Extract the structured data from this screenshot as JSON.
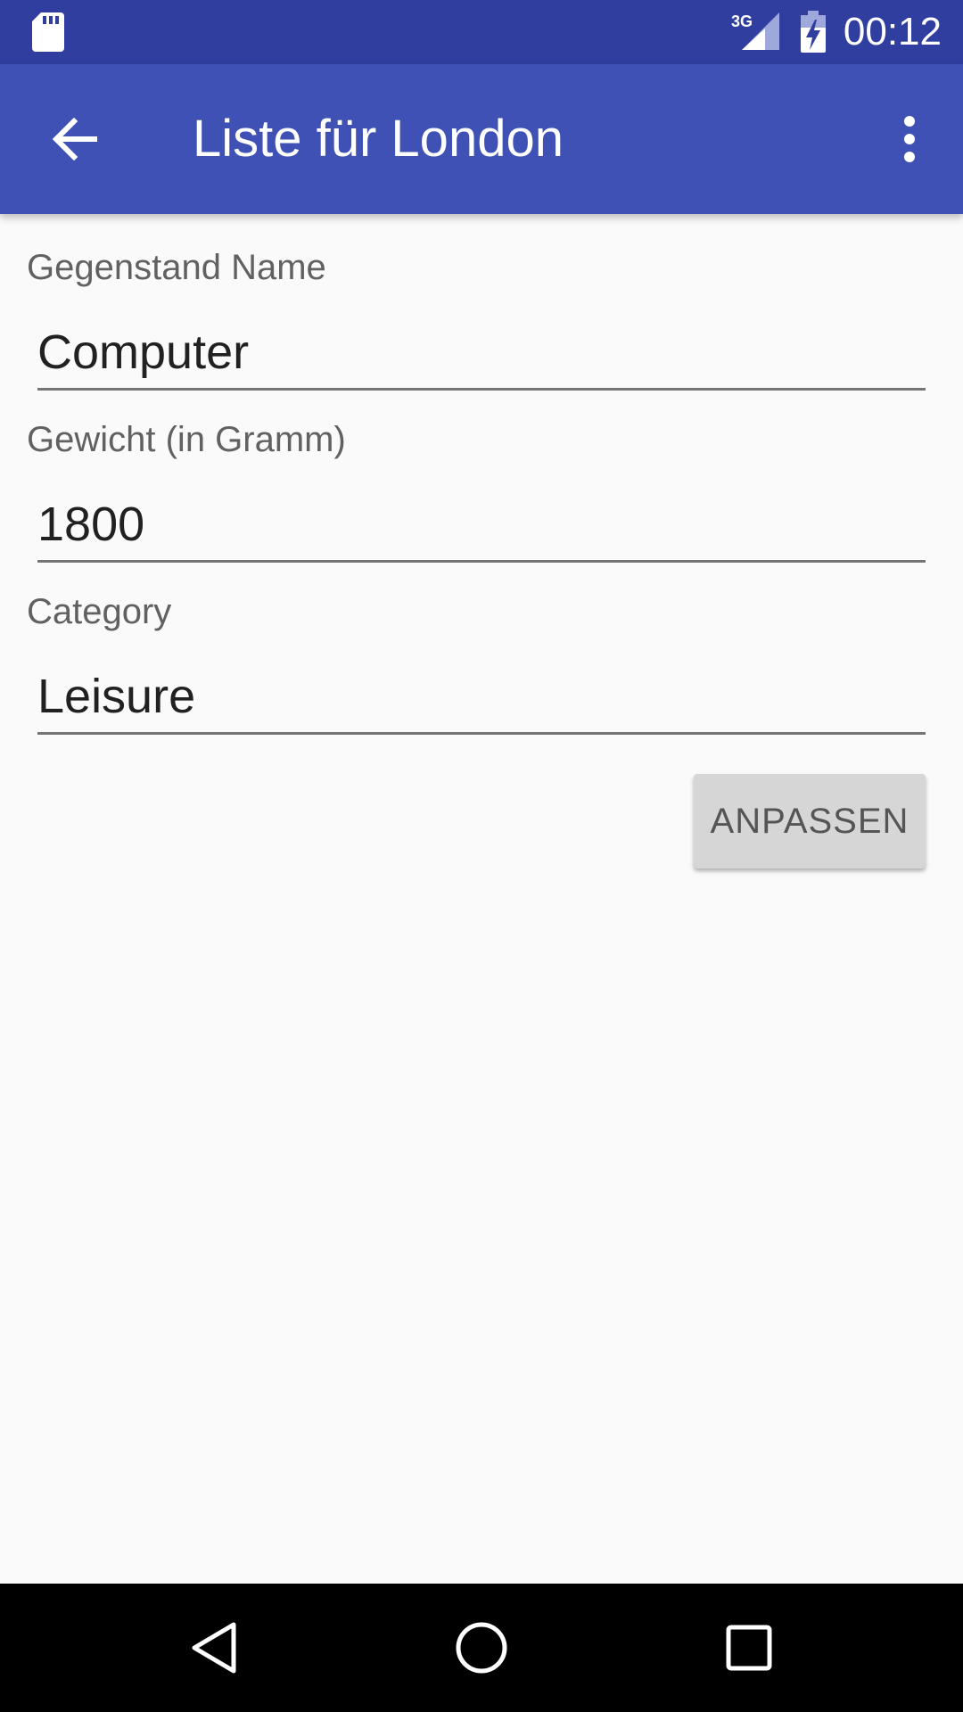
{
  "status_bar": {
    "time": "00:12",
    "network_label": "3G",
    "icons": [
      "sd-card-icon",
      "signal-icon",
      "battery-charging-icon"
    ]
  },
  "app_bar": {
    "title": "Liste für London",
    "back_icon": "arrow-back-icon",
    "menu_icon": "more-vert-icon"
  },
  "form": {
    "name": {
      "label": "Gegenstand Name",
      "value": "Computer"
    },
    "weight": {
      "label": "Gewicht (in Gramm)",
      "value": "1800"
    },
    "category": {
      "label": "Category",
      "value": "Leisure"
    },
    "submit_label": "ANPASSEN"
  },
  "nav_bar": {
    "icons": [
      "back-triangle-icon",
      "home-circle-icon",
      "recents-square-icon"
    ]
  },
  "colors": {
    "status_bar": "#303f9f",
    "app_bar": "#3f51b5",
    "background": "#fafafa",
    "button": "#d6d6d6"
  }
}
